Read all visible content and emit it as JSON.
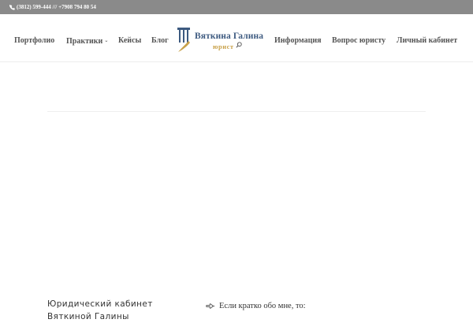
{
  "topbar": {
    "phone_icon": "phone-icon",
    "phones": "(3812) 599-444 /// +7908 794 80 54"
  },
  "nav": {
    "left": [
      {
        "label": "Портфолио"
      },
      {
        "label": "Практики",
        "has_dropdown": true
      },
      {
        "label": "Кейсы"
      },
      {
        "label": "Блог"
      }
    ],
    "right": [
      {
        "label": "Информация"
      },
      {
        "label": "Вопрос юристу"
      },
      {
        "label": "Личный кабинет"
      }
    ],
    "search_icon": "search-icon"
  },
  "logo": {
    "name": "Вяткина Галина",
    "subtitle": "юрист",
    "icon": "column-pen-icon",
    "colors": {
      "blue": "#3d5a80",
      "gold": "#c9a24b"
    }
  },
  "footer": {
    "left_line1": "Юридический кабинет",
    "left_line2": "Вяткиной Галины",
    "right_text": "Если кратко обо мне, то:",
    "right_icon": "pointing-hand-icon"
  },
  "colors": {
    "topbar_bg": "#8a8a8a",
    "nav_text": "#555555"
  }
}
